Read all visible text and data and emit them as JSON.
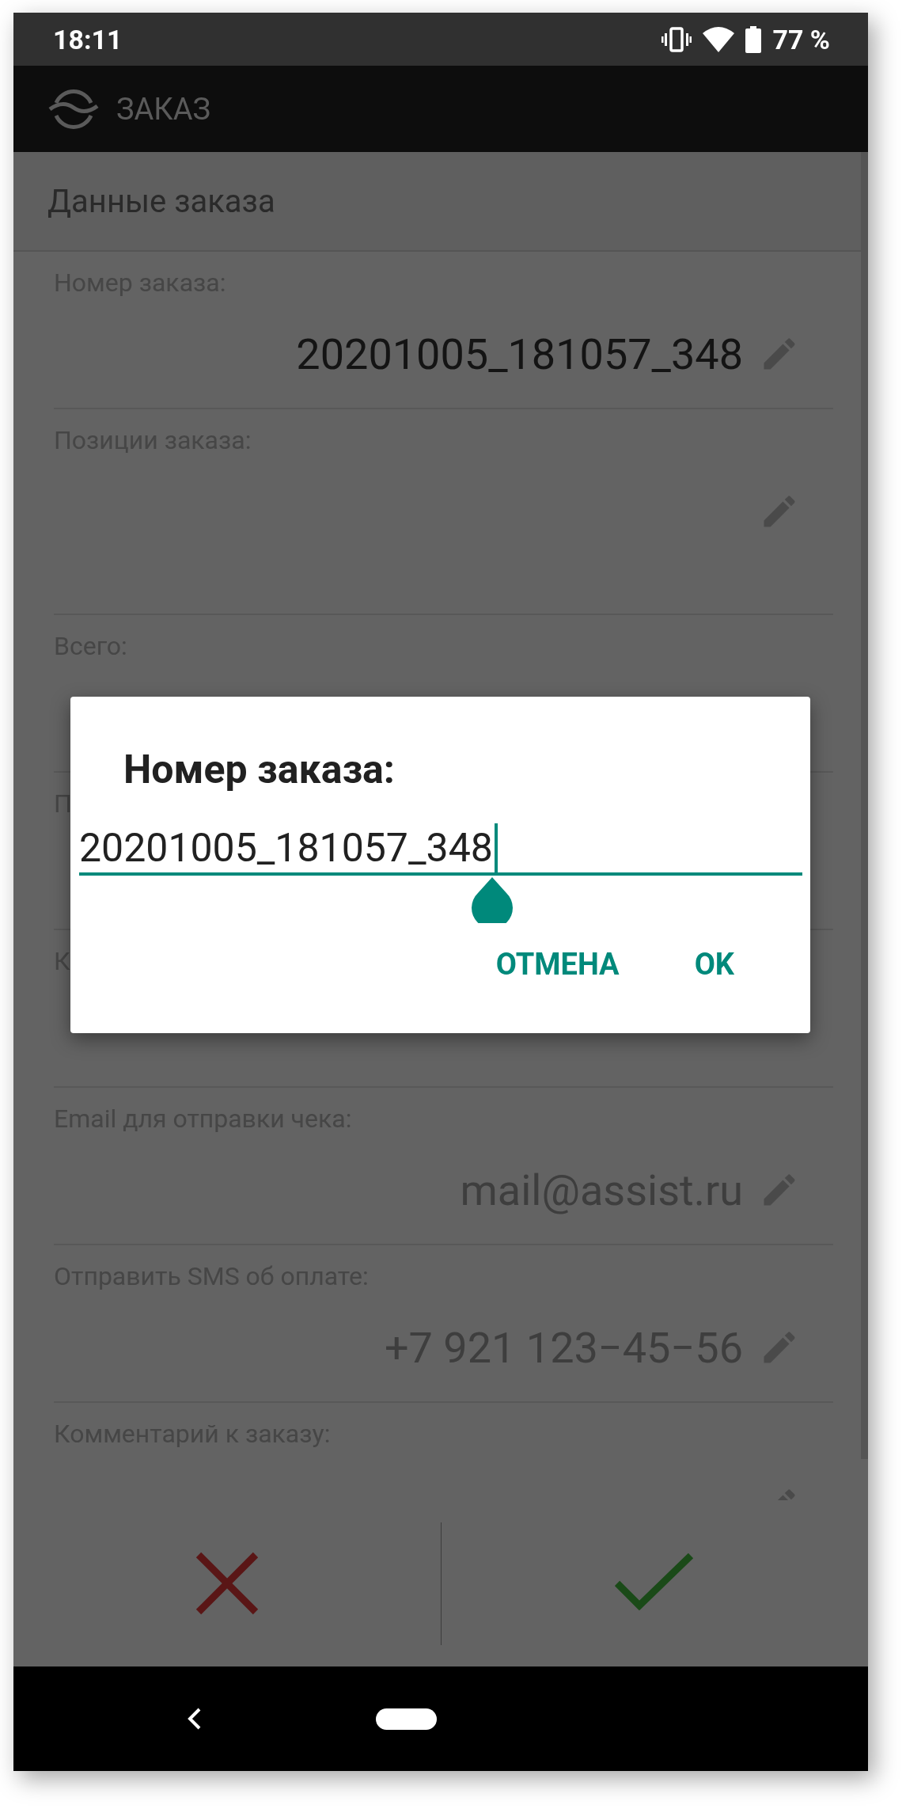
{
  "status_bar": {
    "time": "18:11",
    "battery": "77 %"
  },
  "app_bar": {
    "title": "ЗАКАЗ"
  },
  "section": {
    "title": "Данные заказа"
  },
  "fields": [
    {
      "kind": "text",
      "label": "Номер заказа:",
      "value": "20201005_181057_348",
      "muted": false,
      "editable": true
    },
    {
      "kind": "list",
      "label": "Позиции заказа:",
      "editable": true
    },
    {
      "kind": "text",
      "label": "Всего:"
    },
    {
      "kind": "text",
      "label": "П"
    },
    {
      "kind": "text",
      "label": "К"
    },
    {
      "kind": "text",
      "label": "Email для отправки чека:",
      "value": "mail@assist.ru",
      "muted": true,
      "editable": true
    },
    {
      "kind": "text",
      "label": "Отправить SMS об оплате:",
      "value": "+7 921 123−45−56",
      "muted": true,
      "editable": true
    },
    {
      "kind": "text",
      "label": "Комментарий к заказу:",
      "editable": true
    }
  ],
  "dialog": {
    "title": "Номер заказа:",
    "value": "20201005_181057_348",
    "buttons": [
      "ОТМЕНА",
      "OK"
    ]
  }
}
